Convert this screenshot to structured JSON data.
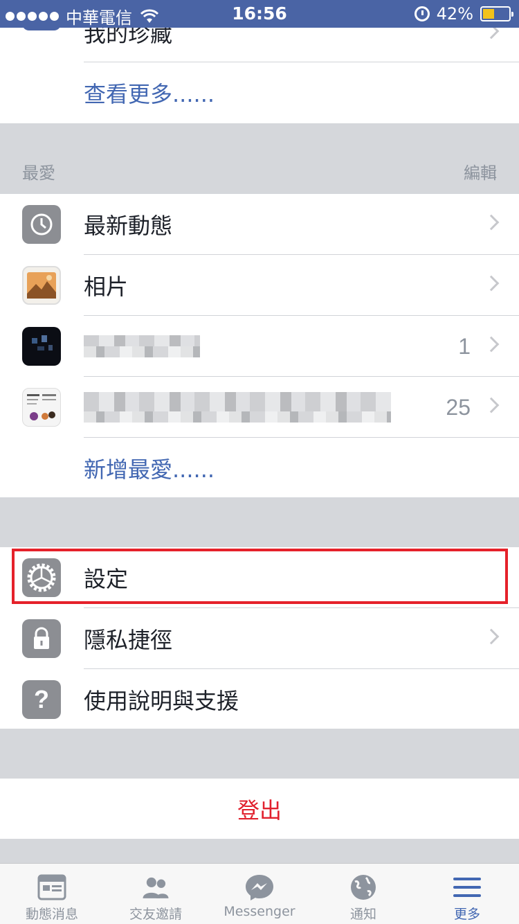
{
  "status_bar": {
    "carrier": "中華電信",
    "time": "16:56",
    "battery": "42%",
    "battery_level": 0.42
  },
  "top_section": {
    "saved_label": "我的珍藏",
    "see_more": "查看更多......"
  },
  "favorites": {
    "header": "最愛",
    "edit": "編輯",
    "items": [
      {
        "label": "最新動態",
        "icon": "clock-icon"
      },
      {
        "label": "相片",
        "icon": "photos-icon"
      },
      {
        "label": "",
        "count": "1",
        "icon": "group-thumbnail-icon"
      },
      {
        "label": "",
        "count": "25",
        "icon": "page-thumbnail-icon"
      }
    ],
    "add_favorite": "新增最愛......"
  },
  "settings_section": {
    "settings": "設定",
    "privacy": "隱私捷徑",
    "help": "使用說明與支援"
  },
  "logout": "登出",
  "tabbar": {
    "tabs": [
      {
        "label": "動態消息",
        "icon": "news-feed-icon"
      },
      {
        "label": "交友邀請",
        "icon": "friend-requests-icon"
      },
      {
        "label": "Messenger",
        "icon": "messenger-icon"
      },
      {
        "label": "通知",
        "icon": "notifications-globe-icon"
      },
      {
        "label": "更多",
        "icon": "menu-icon",
        "active": true
      }
    ]
  },
  "colors": {
    "status_bar_bg": "#4a64a5",
    "link_blue": "#4267b2",
    "logout_red": "#e1212e",
    "highlight_red": "#e5212a"
  }
}
